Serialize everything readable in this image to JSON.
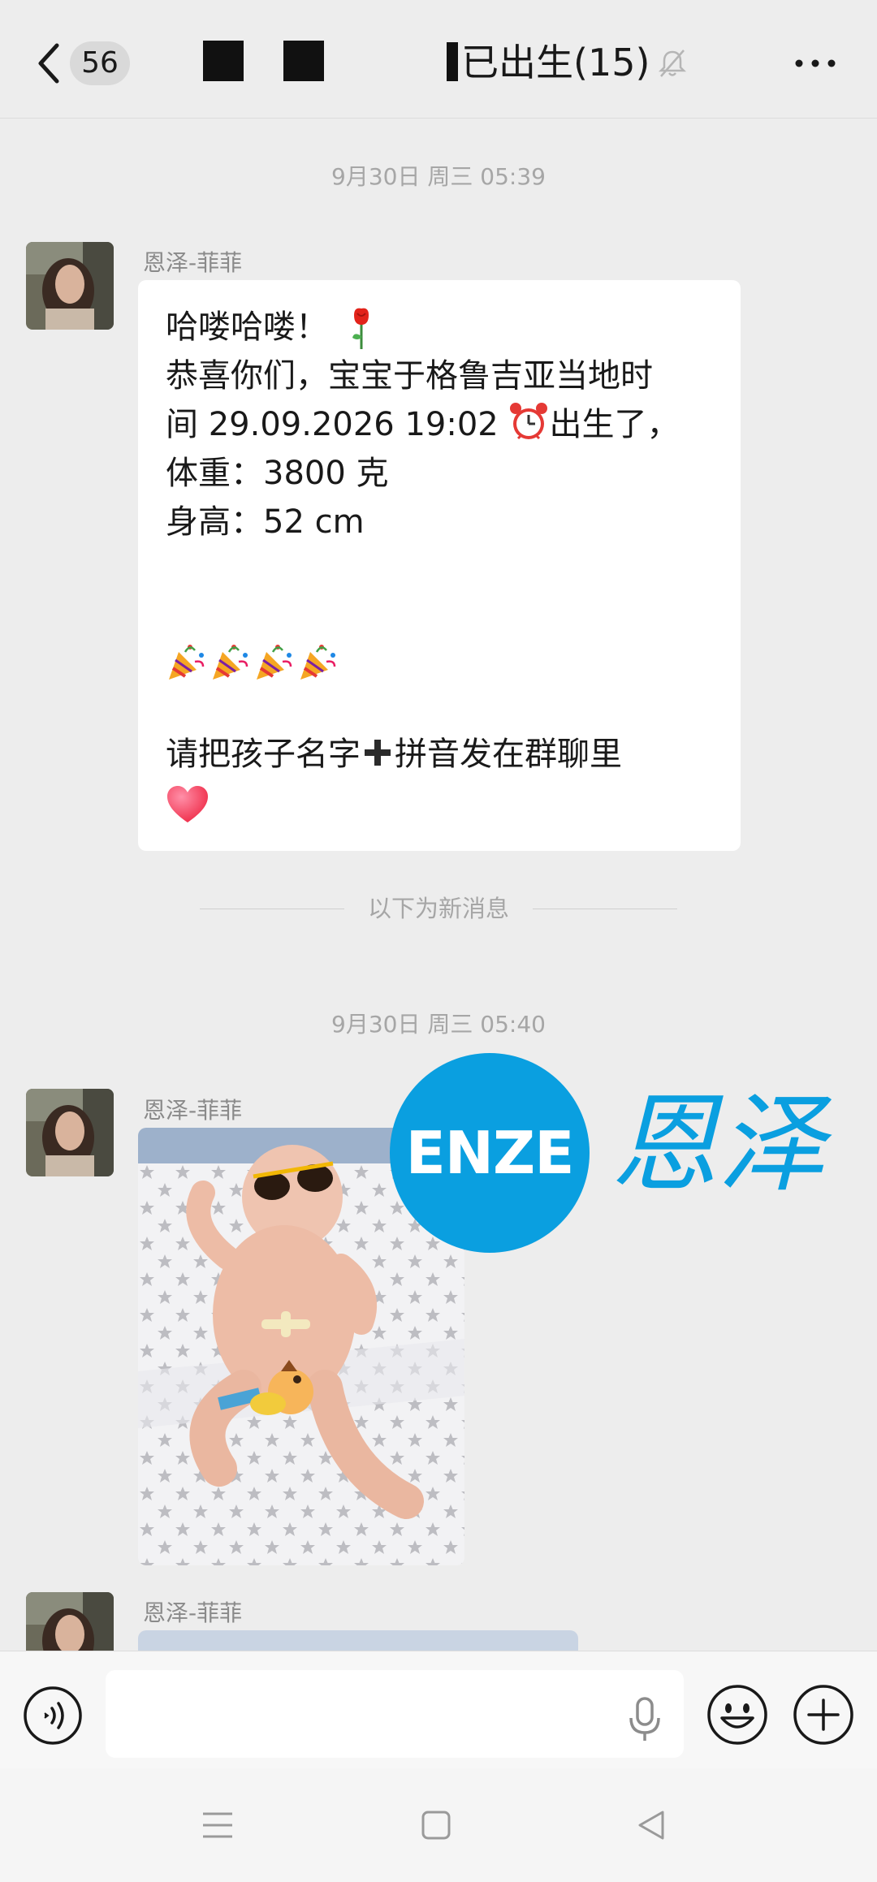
{
  "header": {
    "unread_count": "56",
    "title": "已出生(15)",
    "back_icon": "chevron-left-icon",
    "mute_icon": "bell-off-icon",
    "more_icon": "more-dots-icon"
  },
  "timestamps": {
    "first": "9月30日 周三 05:39",
    "second": "9月30日 周三 05:40"
  },
  "new_message_divider": "以下为新消息",
  "messages": [
    {
      "sender": "恩泽-菲菲",
      "type": "text",
      "line1": "哈喽哈喽！",
      "line2": "恭喜你们，宝宝于格鲁吉亚当地时",
      "line3_a": "间 29.09.2026 19:02 ",
      "line3_b": "出生了，",
      "line4": "体重：3800 克",
      "line5": "身高：52 cm",
      "line6_a": "请把孩子名字",
      "line6_b": "拼音发在群聊里",
      "emojis": [
        "rose",
        "alarm-clock",
        "party-popper",
        "heavy-plus",
        "red-heart"
      ]
    },
    {
      "sender": "恩泽-菲菲",
      "type": "image"
    },
    {
      "sender": "恩泽-菲菲",
      "type": "image"
    }
  ],
  "watermark": {
    "logo_text": "ENZE",
    "brand_text": "恩泽",
    "color": "#0a9fe0"
  },
  "input_bar": {
    "placeholder": "",
    "voice_icon": "voice-mode-icon",
    "mic_icon": "microphone-icon",
    "emoji_icon": "smiley-icon",
    "plus_icon": "plus-circle-icon"
  },
  "nav_bar": {
    "icons": [
      "menu-icon",
      "home-icon",
      "back-triangle-icon"
    ]
  },
  "colors": {
    "background": "#ededed",
    "bubble": "#ffffff",
    "secondary_text": "#a6a6a6",
    "brand": "#0a9fe0"
  }
}
